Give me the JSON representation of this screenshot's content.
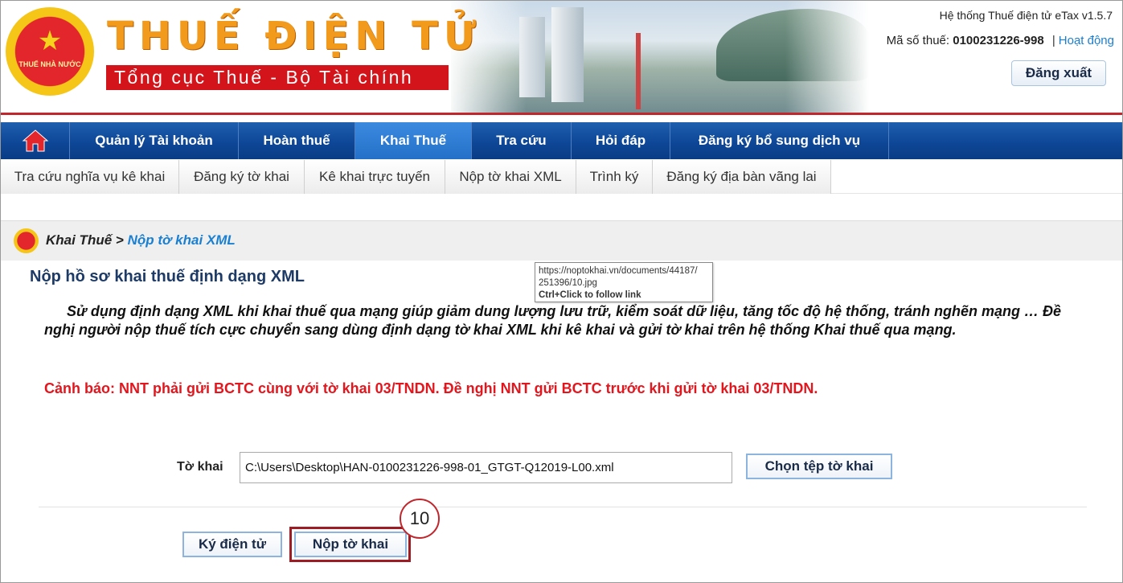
{
  "header": {
    "emblem_text": "THUẾ NHÀ NƯỚC",
    "brand_title": "THUẾ ĐIỆN TỬ",
    "brand_subtitle": "Tổng cục Thuế - Bộ Tài chính",
    "system_info": "Hệ thống Thuế điện tử eTax v1.5.7",
    "tax_id_label": "Mã số thuế:",
    "tax_id_value": "0100231226-998",
    "status_link": "Hoạt động",
    "logout_label": "Đăng xuất"
  },
  "main_nav": {
    "items": [
      {
        "label": "Quản lý Tài khoản"
      },
      {
        "label": "Hoàn thuế"
      },
      {
        "label": "Khai Thuế"
      },
      {
        "label": "Tra cứu"
      },
      {
        "label": "Hỏi đáp"
      },
      {
        "label": "Đăng ký bổ sung dịch vụ"
      }
    ],
    "active": "Khai Thuế"
  },
  "sub_nav": {
    "items": [
      {
        "label": "Tra cứu nghĩa vụ kê khai"
      },
      {
        "label": "Đăng ký tờ khai"
      },
      {
        "label": "Kê khai trực tuyến"
      },
      {
        "label": "Nộp tờ khai XML"
      },
      {
        "label": "Trình ký"
      },
      {
        "label": "Đăng ký địa bàn vãng lai"
      }
    ]
  },
  "breadcrumb": {
    "parent": "Khai Thuế",
    "separator": ">",
    "current": "Nộp tờ khai XML"
  },
  "page_title": "Nộp hồ sơ khai thuế định dạng XML",
  "tooltip": {
    "url_line1": "https://noptokhai.vn/documents/44187/",
    "url_line2": "251396/10.jpg",
    "hint": "Ctrl+Click to follow link"
  },
  "intro_text": "Sử dụng định dạng XML khi khai thuế qua mạng giúp giảm dung lượng lưu trữ, kiểm soát dữ liệu, tăng tốc độ hệ thống, tránh nghẽn mạng … Đề nghị người nộp thuế tích cực chuyển sang dùng định dạng tờ khai XML khi kê khai và gửi tờ khai trên hệ thống Khai thuế qua mạng.",
  "warning_text": "Cảnh báo: NNT phải gửi BCTC cùng với tờ khai 03/TNDN. Đề nghị NNT gửi BCTC trước khi gửi tờ khai 03/TNDN.",
  "form": {
    "file_label": "Tờ khai",
    "file_value": "C:\\Users\\Desktop\\HAN-0100231226-998-01_GTGT-Q12019-L00.xml",
    "choose_button": "Chọn tệp tờ khai",
    "sign_button": "Ký điện tử",
    "submit_button": "Nộp tờ khai"
  },
  "annotation": {
    "step_number": "10",
    "highlight_color": "#9e1d24"
  },
  "colors": {
    "nav_blue": "#0e4797",
    "accent_blue": "#1a7fd1",
    "brand_orange": "#f29a1c",
    "brand_red": "#d3141b",
    "warning_red": "#e3161e"
  },
  "icons": {
    "home": "home-icon",
    "emblem": "emblem-icon"
  }
}
